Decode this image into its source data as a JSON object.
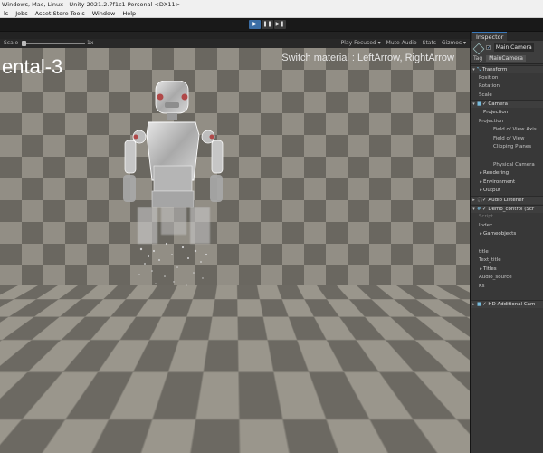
{
  "window": {
    "title": "Windows, Mac, Linux - Unity 2021.2.7f1c1 Personal <DX11>"
  },
  "menu": [
    "ls",
    "Jobs",
    "Asset Store Tools",
    "Window",
    "Help"
  ],
  "play_controls": {
    "play": "▶",
    "pause": "❚❚",
    "step": "▶❚"
  },
  "game_view": {
    "scale_label": "Scale",
    "scale_value": "1x",
    "play_mode": "Play Focused ▾",
    "mute_audio": "Mute Audio",
    "stats": "Stats",
    "gizmos": "Gizmos ▾",
    "overlay_title": "ental-3",
    "overlay_hint": "Switch material : LeftArrow, RightArrow",
    "nav_arrows": "< >"
  },
  "inspector": {
    "tab_label": "Inspector",
    "object_name": "Main Camera",
    "tag_label": "Tag",
    "tag_value": "MainCamera",
    "rows": [
      {
        "type": "comp",
        "arrow": "▾",
        "icon": "⤡",
        "label": "Transform"
      },
      {
        "type": "field",
        "label": "Position"
      },
      {
        "type": "field",
        "label": "Rotation"
      },
      {
        "type": "field",
        "label": "Scale"
      },
      {
        "type": "comp",
        "arrow": "▾",
        "icon": "■",
        "label": "✓ Camera"
      },
      {
        "type": "sub",
        "label": "Projection"
      },
      {
        "type": "field",
        "label": "Projection"
      },
      {
        "type": "field2",
        "label": "Field of View Axis"
      },
      {
        "type": "field2",
        "label": "Field of View"
      },
      {
        "type": "field2",
        "label": "Clipping Planes"
      },
      {
        "type": "blank",
        "label": ""
      },
      {
        "type": "field2",
        "label": "Physical Camera"
      },
      {
        "type": "sub2",
        "label": "Rendering"
      },
      {
        "type": "sub2",
        "label": "Environment"
      },
      {
        "type": "sub2",
        "label": "Output"
      },
      {
        "type": "comp",
        "arrow": "▸",
        "icon": "🎧",
        "label": "✓ Audio Listener"
      },
      {
        "type": "comp",
        "arrow": "▾",
        "icon": "#",
        "label": "✓ Demo_control (Scr"
      },
      {
        "type": "field-dim",
        "label": "Script"
      },
      {
        "type": "field",
        "label": "Index"
      },
      {
        "type": "sub2",
        "label": "Gameobjects"
      },
      {
        "type": "blank",
        "label": ""
      },
      {
        "type": "field",
        "label": "title"
      },
      {
        "type": "field",
        "label": "Text_title"
      },
      {
        "type": "sub2",
        "label": "Titles"
      },
      {
        "type": "field",
        "label": "Audio_source"
      },
      {
        "type": "field",
        "label": "Ks"
      },
      {
        "type": "blank",
        "label": ""
      },
      {
        "type": "comp",
        "arrow": "▸",
        "icon": "■",
        "label": "✓ HD Additional Cam"
      }
    ]
  },
  "colors": {
    "accent": "#3b6ea5",
    "editor_bg": "#191919",
    "inspector_bg": "#383838",
    "wall_light": "#928e85",
    "wall_dark": "#6a6760"
  }
}
